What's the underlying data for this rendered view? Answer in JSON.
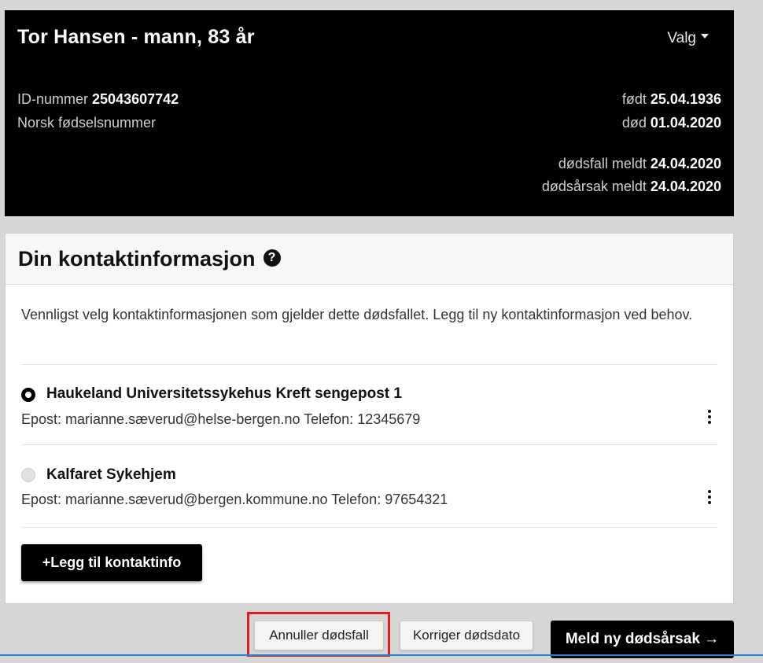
{
  "header": {
    "patient_title": "Tor Hansen - mann, 83 år",
    "menu_label": "Valg",
    "id_label": "ID-nummer",
    "id_value": "25043607742",
    "id_type": "Norsk fødselsnummer",
    "born_label": "født",
    "born_value": "25.04.1936",
    "died_label": "død",
    "died_value": "01.04.2020",
    "death_reported_label": "dødsfall meldt",
    "death_reported_value": "24.04.2020",
    "cause_reported_label": "dødsårsak meldt",
    "cause_reported_value": "24.04.2020"
  },
  "contact_panel": {
    "title": "Din kontaktinformasjon",
    "help_icon": "question-circle-icon",
    "intro": "Vennligst velg kontaktinformasjonen som gjelder dette dødsfallet. Legg til ny kontaktinformasjon ved behov.",
    "options": [
      {
        "name": "Haukeland Universitetssykehus Kreft sengepost 1",
        "detail": "Epost: marianne.sæverud@helse-bergen.no Telefon: 12345679",
        "selected": true
      },
      {
        "name": "Kalfaret Sykehjem",
        "detail": "Epost: marianne.sæverud@bergen.kommune.no Telefon: 97654321",
        "selected": false
      }
    ],
    "add_button": "+Legg til kontaktinfo"
  },
  "actions": {
    "cancel_death": "Annuller dødsfall",
    "correct_date": "Korriger dødsdato",
    "new_cause": "Meld ny dødsårsak →"
  },
  "colors": {
    "header_bg": "#000000",
    "highlight": "#e01e1e",
    "page_bg": "#d6d6d6"
  }
}
